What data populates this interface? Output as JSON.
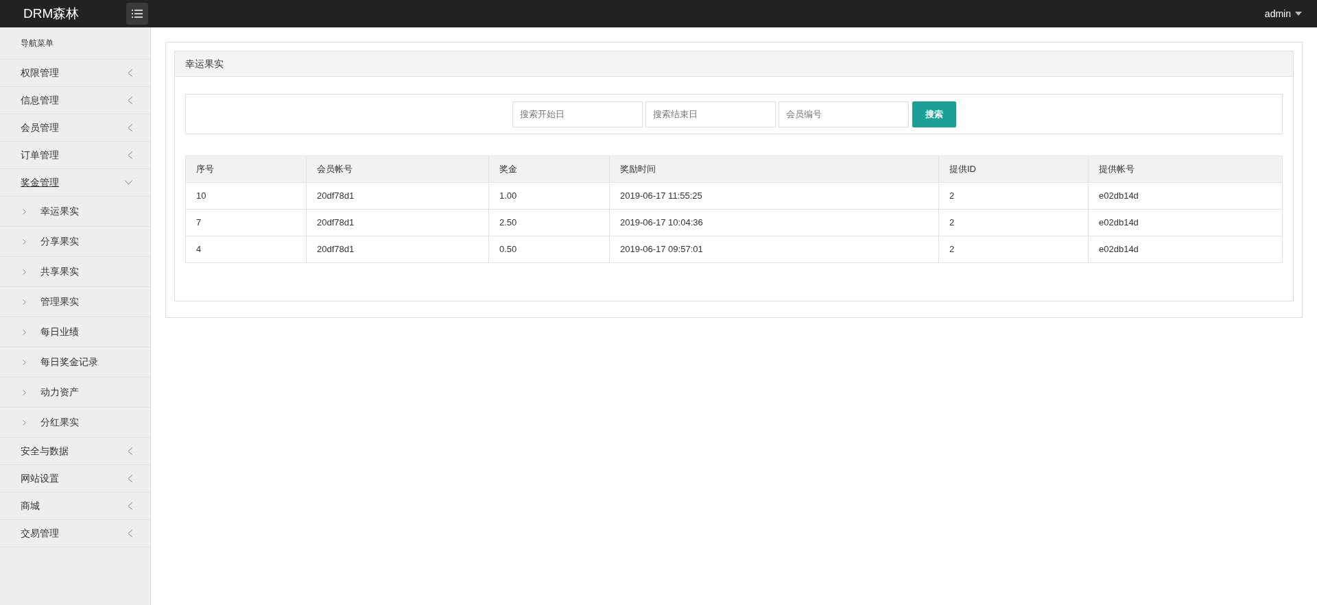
{
  "topbar": {
    "brand": "DRM森林",
    "user": "admin"
  },
  "sidebar": {
    "heading": "导航菜单",
    "items": [
      {
        "label": "权限管理",
        "expanded": false,
        "selected": false
      },
      {
        "label": "信息管理",
        "expanded": false,
        "selected": false
      },
      {
        "label": "会员管理",
        "expanded": false,
        "selected": false
      },
      {
        "label": "订单管理",
        "expanded": false,
        "selected": false
      },
      {
        "label": "奖金管理",
        "expanded": true,
        "selected": true,
        "children": [
          {
            "label": "幸运果实"
          },
          {
            "label": "分享果实"
          },
          {
            "label": "共享果实"
          },
          {
            "label": "管理果实"
          },
          {
            "label": "每日业绩"
          },
          {
            "label": "每日奖金记录"
          },
          {
            "label": "动力资产"
          },
          {
            "label": "分红果实"
          }
        ]
      },
      {
        "label": "安全与数据",
        "expanded": false,
        "selected": false
      },
      {
        "label": "网站设置",
        "expanded": false,
        "selected": false
      },
      {
        "label": "商城",
        "expanded": false,
        "selected": false
      },
      {
        "label": "交易管理",
        "expanded": false,
        "selected": false
      }
    ]
  },
  "panel": {
    "title": "幸运果实",
    "search": {
      "fields": [
        {
          "placeholder": "搜索开始日"
        },
        {
          "placeholder": "搜索结束日"
        },
        {
          "placeholder": "会员编号"
        }
      ],
      "button": "搜索"
    },
    "table": {
      "columns": [
        "序号",
        "会员帐号",
        "奖金",
        "奖励时间",
        "提供ID",
        "提供帐号"
      ],
      "rows": [
        [
          "10",
          "20df78d1",
          "1.00",
          "2019-06-17 11:55:25",
          "2",
          "e02db14d"
        ],
        [
          "7",
          "20df78d1",
          "2.50",
          "2019-06-17 10:04:36",
          "2",
          "e02db14d"
        ],
        [
          "4",
          "20df78d1",
          "0.50",
          "2019-06-17 09:57:01",
          "2",
          "e02db14d"
        ]
      ]
    }
  }
}
